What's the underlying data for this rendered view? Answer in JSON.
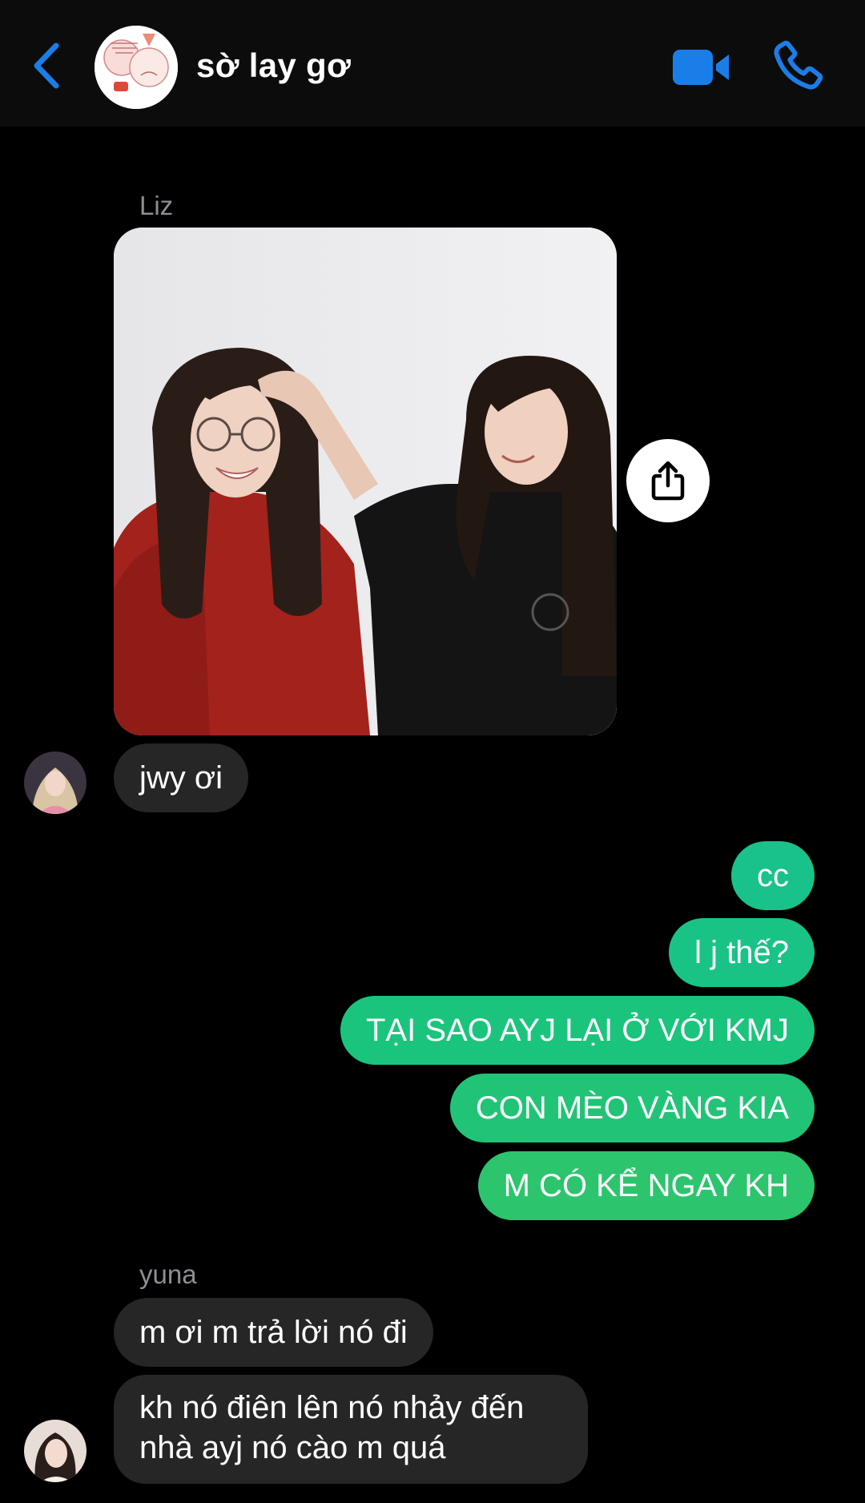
{
  "header": {
    "title": "sờ lay gơ",
    "back_icon": "chevron-left-icon",
    "video_icon": "video-camera-icon",
    "call_icon": "phone-icon",
    "accent_color": "#1a7ee8"
  },
  "messages": {
    "group1": {
      "sender": "Liz",
      "share_icon": "share-icon",
      "text": "jwy ơi"
    },
    "outgoing": [
      {
        "text": "cc",
        "color": "#19c28a"
      },
      {
        "text": "l j thế?",
        "color": "#19c385"
      },
      {
        "text": "TẠI SAO AYJ LẠI Ở VỚI KMJ",
        "color": "#1bc47d"
      },
      {
        "text": "CON MÈO VÀNG KIA",
        "color": "#21c476"
      },
      {
        "text": "M CÓ KỂ NGAY KH",
        "color": "#2cc46d"
      }
    ],
    "group2": {
      "sender": "yuna",
      "text1": "m ơi m trả lời nó đi",
      "text2": "kh nó điên lên nó nhảy đến nhà ayj nó cào m quá"
    }
  },
  "colors": {
    "incoming_bubble": "#262626",
    "background": "#000000",
    "header_bg": "#0c0c0c"
  }
}
